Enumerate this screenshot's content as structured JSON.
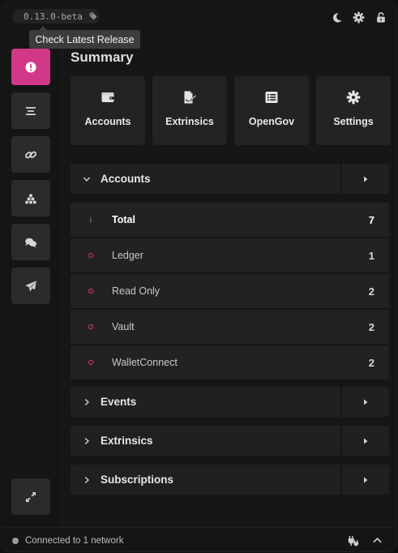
{
  "app": {
    "version": "0.13.0-beta",
    "tooltip": "Check Latest Release"
  },
  "topbar": {
    "icons": [
      "moon-icon",
      "gear-icon",
      "unlock-icon"
    ]
  },
  "sidebar": {
    "items": [
      {
        "name": "summary",
        "icon": "info-icon",
        "active": true
      },
      {
        "name": "list",
        "icon": "list-icon",
        "active": false
      },
      {
        "name": "links",
        "icon": "link-icon",
        "active": false
      },
      {
        "name": "network",
        "icon": "cubes-icon",
        "active": false
      },
      {
        "name": "chat",
        "icon": "comments-icon",
        "active": false
      },
      {
        "name": "send",
        "icon": "paper-plane-icon",
        "active": false
      }
    ],
    "bottom": {
      "icon": "expand-icon"
    }
  },
  "main": {
    "title": "Summary",
    "cards": [
      {
        "label": "Accounts",
        "icon": "wallet-icon"
      },
      {
        "label": "Extrinsics",
        "icon": "file-signature-icon"
      },
      {
        "label": "OpenGov",
        "icon": "list-alt-icon"
      },
      {
        "label": "Settings",
        "icon": "gear-icon"
      }
    ],
    "accounts_section": {
      "label": "Accounts",
      "rows": [
        {
          "name": "Total",
          "count": "7",
          "icon": "info-icon"
        },
        {
          "name": "Ledger",
          "count": "1",
          "icon": "circle-icon"
        },
        {
          "name": "Read Only",
          "count": "2",
          "icon": "circle-icon"
        },
        {
          "name": "Vault",
          "count": "2",
          "icon": "circle-icon"
        },
        {
          "name": "WalletConnect",
          "count": "2",
          "icon": "circle-icon"
        }
      ]
    },
    "sections": [
      {
        "label": "Events"
      },
      {
        "label": "Extrinsics"
      },
      {
        "label": "Subscriptions"
      }
    ]
  },
  "footer": {
    "status": "Connected to 1 network"
  },
  "colors": {
    "accent": "#d23888",
    "background": "#151515",
    "card": "#232323"
  }
}
